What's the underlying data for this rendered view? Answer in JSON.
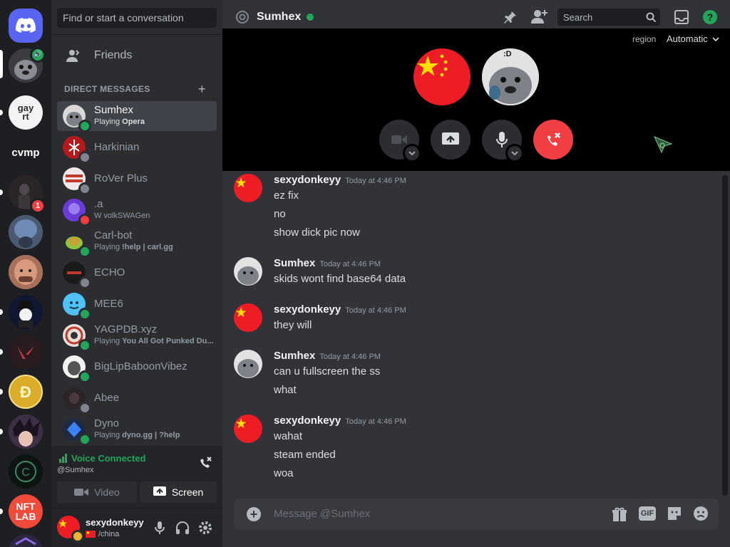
{
  "find_placeholder": "Find or start a conversation",
  "nav": {
    "friends": "Friends",
    "dm_header": "DIRECT MESSAGES",
    "add": "+"
  },
  "servers": {
    "cvmp": "cvmp",
    "gay": "gay\nrt",
    "nft": "NFT\nLAB",
    "badge": "1"
  },
  "dms": [
    {
      "name": "Sumhex",
      "sub_prefix": "Playing ",
      "sub_bold": "Opera",
      "status": "on"
    },
    {
      "name": "Harkinian",
      "sub_prefix": "",
      "sub_bold": "",
      "status": "off"
    },
    {
      "name": "RoVer Plus",
      "sub_prefix": "",
      "sub_bold": "",
      "status": "off"
    },
    {
      "name": ".a",
      "sub_prefix": "W volkSWAGen",
      "sub_bold": "",
      "status": "dnd"
    },
    {
      "name": "Carl-bot",
      "sub_prefix": "Playing ",
      "sub_bold": "!help | carl.gg",
      "status": "on"
    },
    {
      "name": "ECHO",
      "sub_prefix": "",
      "sub_bold": "",
      "status": "off"
    },
    {
      "name": "MEE6",
      "sub_prefix": "",
      "sub_bold": "",
      "status": "on"
    },
    {
      "name": "YAGPDB.xyz",
      "sub_prefix": "Playing ",
      "sub_bold": "You All Got Punked Du...",
      "status": "on"
    },
    {
      "name": "BigLipBaboonVibez",
      "sub_prefix": "",
      "sub_bold": "",
      "status": "on"
    },
    {
      "name": "Abee",
      "sub_prefix": "",
      "sub_bold": "",
      "status": "off"
    },
    {
      "name": "Dyno",
      "sub_prefix": "Playing ",
      "sub_bold": "dyno.gg | ?help",
      "status": "on"
    }
  ],
  "voice": {
    "status": "Voice Connected",
    "channel": "@Sumhex",
    "video": "Video",
    "screen": "Screen"
  },
  "user": {
    "name": "sexydonkeyy",
    "status": "/china"
  },
  "header": {
    "title": "Sumhex",
    "search": "Search",
    "region_label": "region",
    "region_value": "Automatic"
  },
  "call": {
    "tile_label": ":D"
  },
  "messages": [
    {
      "author": "sexydonkeyy",
      "time": "Today at 4:46 PM",
      "lines": [
        "ez fix",
        "no",
        "show dick pic now"
      ]
    },
    {
      "author": "Sumhex",
      "time": "Today at 4:46 PM",
      "lines": [
        "skids wont find base64 data"
      ]
    },
    {
      "author": "sexydonkeyy",
      "time": "Today at 4:46 PM",
      "lines": [
        "they will"
      ]
    },
    {
      "author": "Sumhex",
      "time": "Today at 4:46 PM",
      "lines": [
        "can u fullscreen the ss",
        "what"
      ]
    },
    {
      "author": "sexydonkeyy",
      "time": "Today at 4:46 PM",
      "lines": [
        "wahat",
        "steam ended",
        "woa"
      ]
    }
  ],
  "composer": {
    "placeholder": "Message @Sumhex",
    "gif": "GIF"
  },
  "colors": {
    "accent": "#5865f2",
    "online": "#23a55a",
    "danger": "#f23f43",
    "flag_red": "#ee1c25",
    "flag_star": "#ffde00"
  }
}
